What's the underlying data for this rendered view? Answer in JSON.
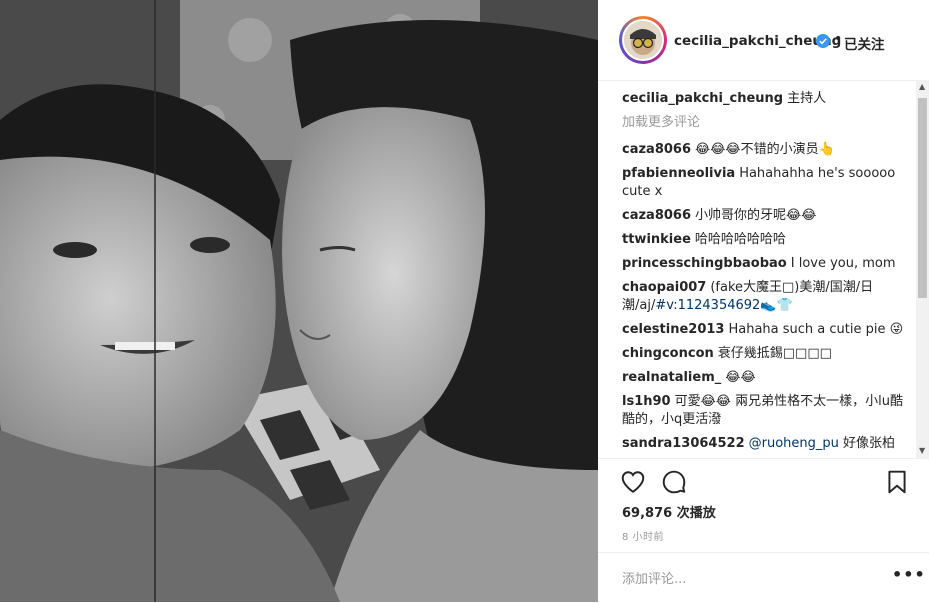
{
  "post": {
    "username": "cecilia_pakchi_cheung",
    "follow_label": "已关注",
    "separator": "•",
    "caption_user": "cecilia_pakchi_cheung",
    "caption_text": "主持人",
    "load_more": "加载更多评论",
    "views": "69,876 次播放",
    "time_ago": "8 小时前",
    "add_comment_placeholder": "添加评论..."
  },
  "comments": [
    {
      "user": "caza8066",
      "text": "😂😂😂不错的小演员👆"
    },
    {
      "user": "pfabienneolivia",
      "text": "Hahahahha he's sooooo cute x"
    },
    {
      "user": "caza8066",
      "text": "小帅哥你的牙呢😂😂"
    },
    {
      "user": "ttwinkiee",
      "text": "哈哈哈哈哈哈哈"
    },
    {
      "user": "princesschingbbaobao",
      "text": "I love you, mom"
    },
    {
      "user": "chaopai007",
      "text": "(fake大魔王□)美潮/国潮/日潮/aj/",
      "link": "#v:1124354692",
      "suffix": "👟👕"
    },
    {
      "user": "celestine2013",
      "text": "Hahaha such a cutie pie 😜"
    },
    {
      "user": "chingconcon",
      "text": "衰仔幾抵錫□□□□"
    },
    {
      "user": "realnataliem_",
      "text": "😂😂"
    },
    {
      "user": "ls1h90",
      "text": "可愛😂😂 兩兄弟性格不太一樣，小lu酷酷的，小q更活潑"
    },
    {
      "user": "sandra13064522",
      "link": "@ruoheng_pu",
      "text": "好像张柏"
    }
  ],
  "icons": {
    "like": "heart-icon",
    "comment": "comment-icon",
    "save": "bookmark-icon",
    "verified": "verified-badge-icon",
    "more": "more-options-icon"
  },
  "colors": {
    "link": "#003569",
    "verified": "#3897f0",
    "muted": "#999999"
  }
}
